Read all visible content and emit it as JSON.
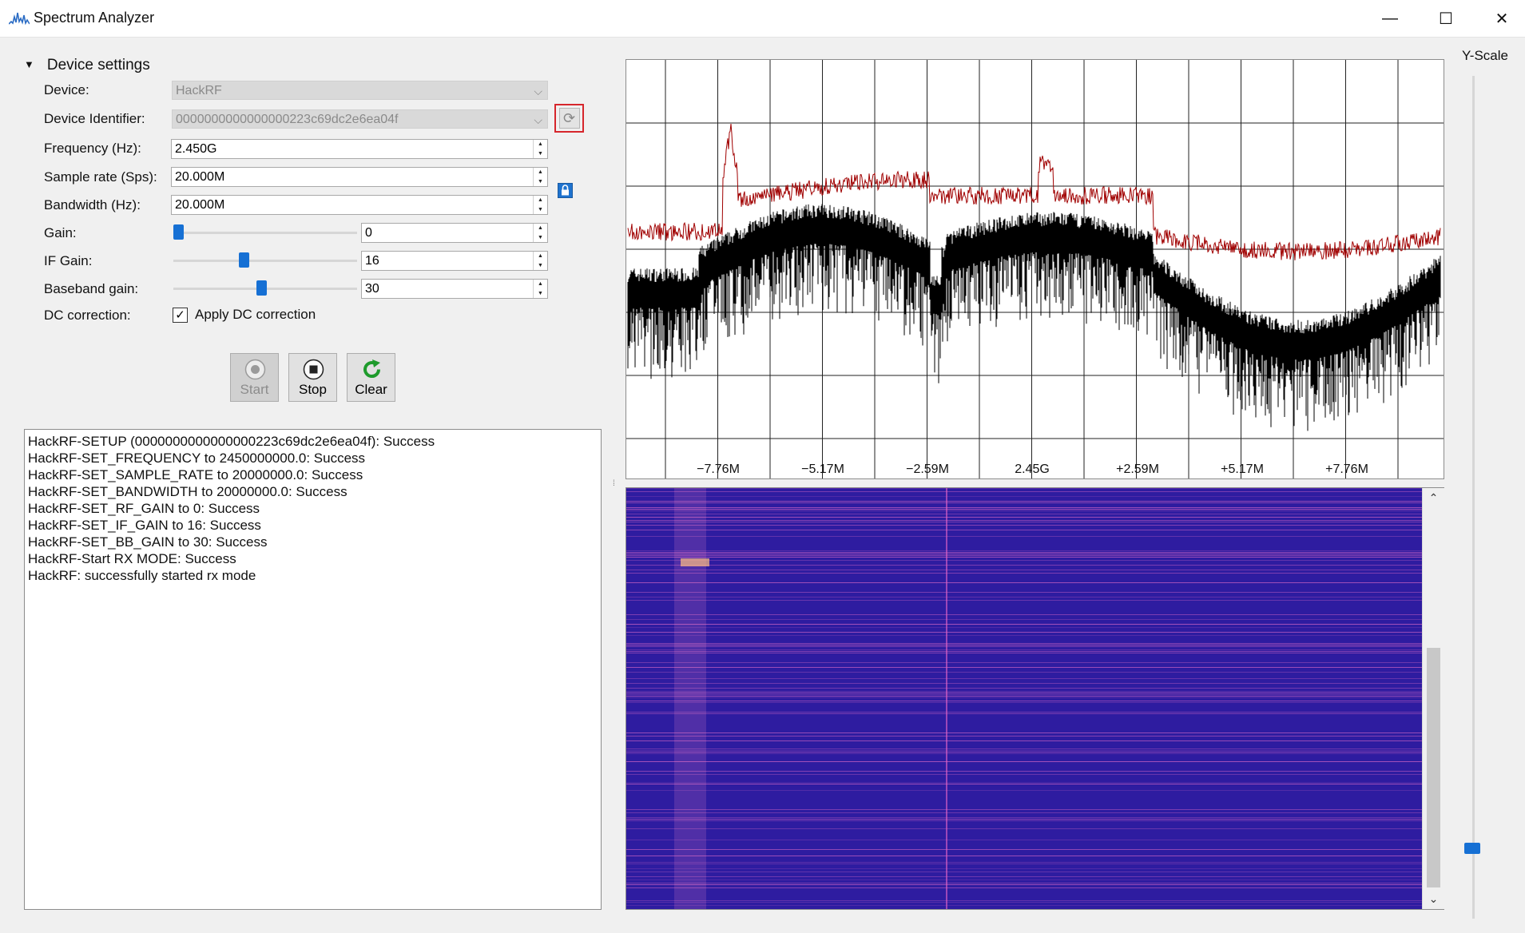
{
  "window": {
    "title": "Spectrum Analyzer",
    "minimize": "—",
    "maximize": "☐",
    "close": "✕"
  },
  "device_settings": {
    "header": "Device settings",
    "device": {
      "label": "Device:",
      "value": "HackRF"
    },
    "device_identifier": {
      "label": "Device Identifier:",
      "value": "0000000000000000223c69dc2e6ea04f"
    },
    "frequency": {
      "label": "Frequency (Hz):",
      "value": "2.450G"
    },
    "sample_rate": {
      "label": "Sample rate (Sps):",
      "value": "20.000M"
    },
    "bandwidth": {
      "label": "Bandwidth (Hz):",
      "value": "20.000M"
    },
    "gain": {
      "label": "Gain:",
      "value": "0",
      "slider_fraction": 0.0
    },
    "if_gain": {
      "label": "IF Gain:",
      "value": "16",
      "slider_fraction": 0.38
    },
    "baseband_gain": {
      "label": "Baseband gain:",
      "value": "30",
      "slider_fraction": 0.48
    },
    "dc_correction": {
      "label": "DC correction:",
      "checkbox_label": "Apply DC correction",
      "checked": true
    }
  },
  "buttons": {
    "start": "Start",
    "stop": "Stop",
    "clear": "Clear"
  },
  "log": [
    "HackRF-SETUP (0000000000000000223c69dc2e6ea04f): Success",
    "HackRF-SET_FREQUENCY to 2450000000.0: Success",
    "HackRF-SET_SAMPLE_RATE to 20000000.0: Success",
    "HackRF-SET_BANDWIDTH to 20000000.0: Success",
    "HackRF-SET_RF_GAIN to 0: Success",
    "HackRF-SET_IF_GAIN to 16: Success",
    "HackRF-SET_BB_GAIN to 30: Success",
    "HackRF-Start RX MODE: Success",
    "HackRF: successfully started rx mode"
  ],
  "spectrum": {
    "tick_labels": [
      "−7.76M",
      "−5.17M",
      "−2.59M",
      "2.45G",
      "+2.59M",
      "+5.17M",
      "+7.76M"
    ],
    "peak_hold_color": "#a00000",
    "live_trace_color": "#000000"
  },
  "yscale": {
    "label": "Y-Scale",
    "level_fraction": 0.88
  },
  "colors": {
    "accent": "#1670d4",
    "waterfall_bg": "#2e1ca0",
    "highlight": "#d6262c"
  }
}
